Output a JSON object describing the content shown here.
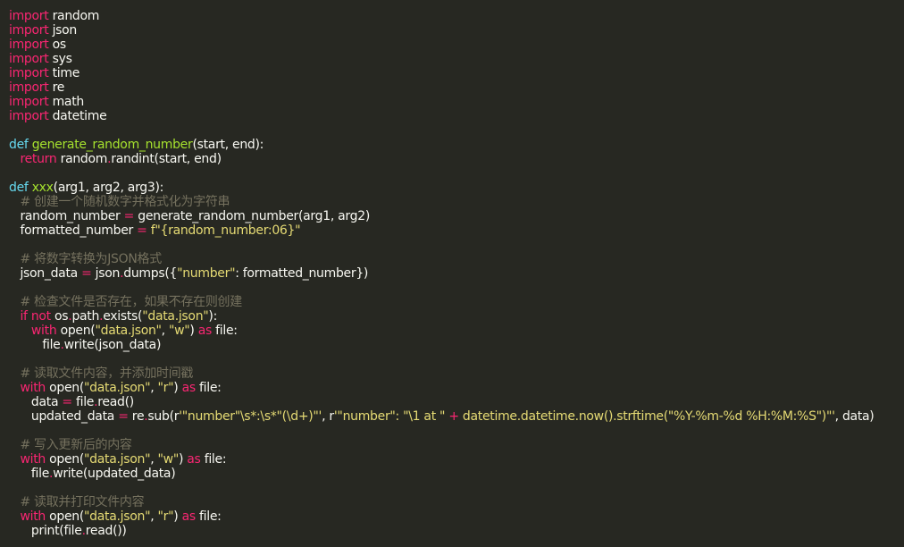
{
  "colors": {
    "background": "#272822",
    "keyword": "#f92672",
    "function": "#a6e22e",
    "string": "#e6db74",
    "comment": "#75715e",
    "number": "#ae81ff",
    "builtin": "#66d9ef",
    "text": "#f8f8f2"
  },
  "code": {
    "lines": [
      [
        [
          "kw",
          "import"
        ],
        [
          "pl",
          " random"
        ]
      ],
      [
        [
          "kw",
          "import"
        ],
        [
          "pl",
          " json"
        ]
      ],
      [
        [
          "kw",
          "import"
        ],
        [
          "pl",
          " os"
        ]
      ],
      [
        [
          "kw",
          "import"
        ],
        [
          "pl",
          " sys"
        ]
      ],
      [
        [
          "kw",
          "import"
        ],
        [
          "pl",
          " time"
        ]
      ],
      [
        [
          "kw",
          "import"
        ],
        [
          "pl",
          " re"
        ]
      ],
      [
        [
          "kw",
          "import"
        ],
        [
          "pl",
          " math"
        ]
      ],
      [
        [
          "kw",
          "import"
        ],
        [
          "pl",
          " datetime"
        ]
      ],
      [],
      [
        [
          "df",
          "def"
        ],
        [
          "pl",
          " "
        ],
        [
          "fn",
          "generate_random_number"
        ],
        [
          "pl",
          "(start, end):"
        ]
      ],
      [
        [
          "pl",
          "   "
        ],
        [
          "kw",
          "return"
        ],
        [
          "pl",
          " random"
        ],
        [
          "op",
          "."
        ],
        [
          "pl",
          "randint(start, end)"
        ]
      ],
      [],
      [
        [
          "df",
          "def"
        ],
        [
          "pl",
          " "
        ],
        [
          "fn",
          "xxx"
        ],
        [
          "pl",
          "(arg1, arg2, arg3):"
        ]
      ],
      [
        [
          "pl",
          "   "
        ],
        [
          "cm",
          "# 创建一个随机数字并格式化为字符串"
        ]
      ],
      [
        [
          "pl",
          "   random_number "
        ],
        [
          "op",
          "="
        ],
        [
          "pl",
          " generate_random_number(arg1, arg2)"
        ]
      ],
      [
        [
          "pl",
          "   formatted_number "
        ],
        [
          "op",
          "="
        ],
        [
          "pl",
          " "
        ],
        [
          "st",
          "f\"{random_number:06}\""
        ]
      ],
      [],
      [
        [
          "pl",
          "   "
        ],
        [
          "cm",
          "# 将数字转换为JSON格式"
        ]
      ],
      [
        [
          "pl",
          "   json_data "
        ],
        [
          "op",
          "="
        ],
        [
          "pl",
          " json"
        ],
        [
          "op",
          "."
        ],
        [
          "pl",
          "dumps({"
        ],
        [
          "st",
          "\"number\""
        ],
        [
          "pl",
          ": formatted_number})"
        ]
      ],
      [],
      [
        [
          "pl",
          "   "
        ],
        [
          "cm",
          "# 检查文件是否存在，如果不存在则创建"
        ]
      ],
      [
        [
          "pl",
          "   "
        ],
        [
          "kw",
          "if"
        ],
        [
          "pl",
          " "
        ],
        [
          "kw",
          "not"
        ],
        [
          "pl",
          " os"
        ],
        [
          "op",
          "."
        ],
        [
          "pl",
          "path"
        ],
        [
          "op",
          "."
        ],
        [
          "pl",
          "exists("
        ],
        [
          "st",
          "\"data.json\""
        ],
        [
          "pl",
          "):"
        ]
      ],
      [
        [
          "pl",
          "      "
        ],
        [
          "kw",
          "with"
        ],
        [
          "pl",
          " open("
        ],
        [
          "st",
          "\"data.json\""
        ],
        [
          "pl",
          ", "
        ],
        [
          "st",
          "\"w\""
        ],
        [
          "pl",
          ") "
        ],
        [
          "kw",
          "as"
        ],
        [
          "pl",
          " file:"
        ]
      ],
      [
        [
          "pl",
          "         file"
        ],
        [
          "op",
          "."
        ],
        [
          "pl",
          "write(json_data)"
        ]
      ],
      [],
      [
        [
          "pl",
          "   "
        ],
        [
          "cm",
          "# 读取文件内容，并添加时间戳"
        ]
      ],
      [
        [
          "pl",
          "   "
        ],
        [
          "kw",
          "with"
        ],
        [
          "pl",
          " open("
        ],
        [
          "st",
          "\"data.json\""
        ],
        [
          "pl",
          ", "
        ],
        [
          "st",
          "\"r\""
        ],
        [
          "pl",
          ") "
        ],
        [
          "kw",
          "as"
        ],
        [
          "pl",
          " file:"
        ]
      ],
      [
        [
          "pl",
          "      data "
        ],
        [
          "op",
          "="
        ],
        [
          "pl",
          " file"
        ],
        [
          "op",
          "."
        ],
        [
          "pl",
          "read()"
        ]
      ],
      [
        [
          "pl",
          "      updated_data "
        ],
        [
          "op",
          "="
        ],
        [
          "pl",
          " re"
        ],
        [
          "op",
          "."
        ],
        [
          "pl",
          "sub(r"
        ],
        [
          "st",
          "'\"number\"\\s*:\\s*\"(\\d+)\"'"
        ],
        [
          "pl",
          ", r"
        ],
        [
          "st",
          "'\"number\": \"\\1 at \" "
        ],
        [
          "op",
          "+"
        ],
        [
          "st",
          " datetime.datetime.now().strftime(\"%Y-%m-%d %H:%M:%S\")\"'"
        ],
        [
          "pl",
          ", data)"
        ]
      ],
      [],
      [
        [
          "pl",
          "   "
        ],
        [
          "cm",
          "# 写入更新后的内容"
        ]
      ],
      [
        [
          "pl",
          "   "
        ],
        [
          "kw",
          "with"
        ],
        [
          "pl",
          " open("
        ],
        [
          "st",
          "\"data.json\""
        ],
        [
          "pl",
          ", "
        ],
        [
          "st",
          "\"w\""
        ],
        [
          "pl",
          ") "
        ],
        [
          "kw",
          "as"
        ],
        [
          "pl",
          " file:"
        ]
      ],
      [
        [
          "pl",
          "      file"
        ],
        [
          "op",
          "."
        ],
        [
          "pl",
          "write(updated_data)"
        ]
      ],
      [],
      [
        [
          "pl",
          "   "
        ],
        [
          "cm",
          "# 读取并打印文件内容"
        ]
      ],
      [
        [
          "pl",
          "   "
        ],
        [
          "kw",
          "with"
        ],
        [
          "pl",
          " open("
        ],
        [
          "st",
          "\"data.json\""
        ],
        [
          "pl",
          ", "
        ],
        [
          "st",
          "\"r\""
        ],
        [
          "pl",
          ") "
        ],
        [
          "kw",
          "as"
        ],
        [
          "pl",
          " file:"
        ]
      ],
      [
        [
          "pl",
          "      print(file"
        ],
        [
          "op",
          "."
        ],
        [
          "pl",
          "read())"
        ]
      ]
    ]
  }
}
